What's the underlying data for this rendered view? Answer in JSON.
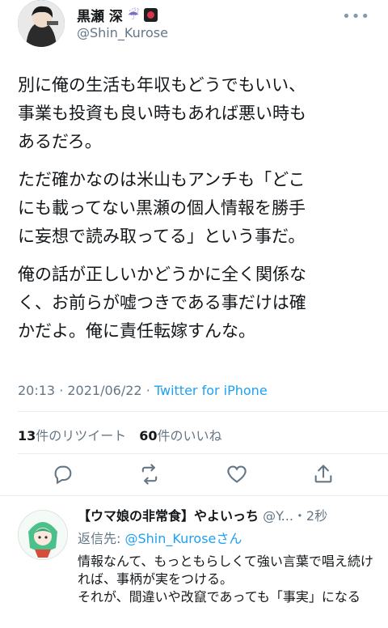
{
  "header": {
    "display_name": "黒瀬 深",
    "emoji_1": "umbrella-with-rain-icon",
    "emoji_2": "hanafuda-icon",
    "handle": "@Shin_Kurose"
  },
  "tweet": {
    "paragraphs": [
      "別に俺の生活も年収もどうでもいい、\n事業も投資も良い時もあれば悪い時も\nあるだろ。",
      "ただ確かなのは米山もアンチも「どこ\nにも載ってない黒瀬の個人情報を勝手\nに妄想で読み取ってる」という事だ。",
      "俺の話が正しいかどうかに全く関係な\nく、お前らが嘘つきである事だけは確\nかだよ。俺に責任転嫁すんな。"
    ],
    "time": "20:13",
    "date": "2021/06/22",
    "source": "Twitter for iPhone"
  },
  "stats": {
    "retweets_count": "13",
    "retweets_label": "件のリツイート",
    "likes_count": "60",
    "likes_label": "件のいいね"
  },
  "reply": {
    "name": "【ウマ娘の非常食】やよいっち",
    "handle": "@Y...",
    "time": "・2秒",
    "reply_to_prefix": "返信先: ",
    "reply_to_mention": "@Shin_Kurose",
    "reply_to_suffix": "さん",
    "text": "情報なんて、もっともらしくて強い言葉で唱え続ければ、事柄が実をつける。\nそれが、間違いや改竄であっても「事実」になる"
  },
  "colors": {
    "link": "#1da1f2",
    "secondary_text": "#657786",
    "primary_text": "#14171a",
    "divider": "#e6ecf0"
  }
}
